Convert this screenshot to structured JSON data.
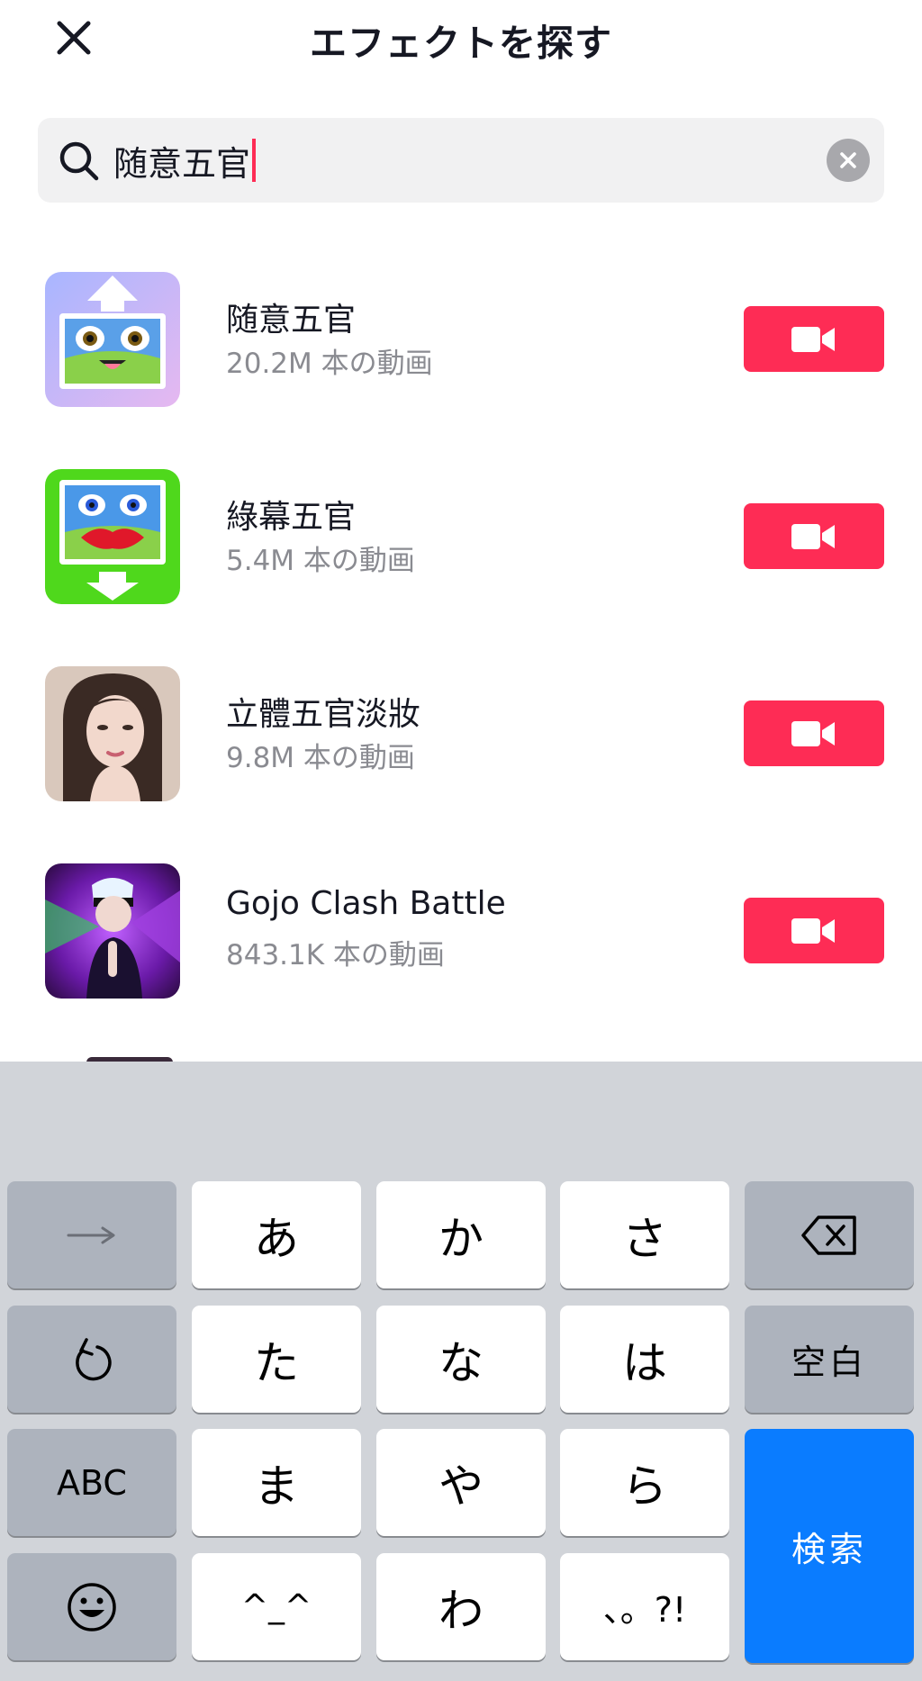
{
  "header": {
    "title": "エフェクトを探す",
    "close_icon": "close-icon"
  },
  "search": {
    "value": "随意五官",
    "search_icon": "search-icon",
    "clear_icon": "clear-icon"
  },
  "effects": [
    {
      "name": "随意五官",
      "count": "20.2M 本の動画",
      "thumb": "face-up-arrow-thumbnail"
    },
    {
      "name": "綠幕五官",
      "count": "5.4M 本の動画",
      "thumb": "green-screen-lips-thumbnail"
    },
    {
      "name": "立體五官淡妝",
      "count": "9.8M 本の動画",
      "thumb": "portrait-makeup-thumbnail"
    },
    {
      "name": "Gojo Clash Battle",
      "count": "843.1K 本の動画",
      "thumb": "anime-battle-thumbnail"
    }
  ],
  "record_icon": "video-camera-icon",
  "keyboard": {
    "row1": [
      "→",
      "あ",
      "か",
      "さ",
      "⌫"
    ],
    "row2": [
      "↺",
      "た",
      "な",
      "は",
      "空白"
    ],
    "row3": [
      "ABC",
      "ま",
      "や",
      "ら"
    ],
    "row4": [
      "☺",
      "^_^",
      "わ",
      "、。?!"
    ],
    "search_key": "検索"
  },
  "colors": {
    "accent": "#fe2c55",
    "keyboard_blue": "#0a7cff",
    "keyboard_bg": "#d1d4d9"
  }
}
